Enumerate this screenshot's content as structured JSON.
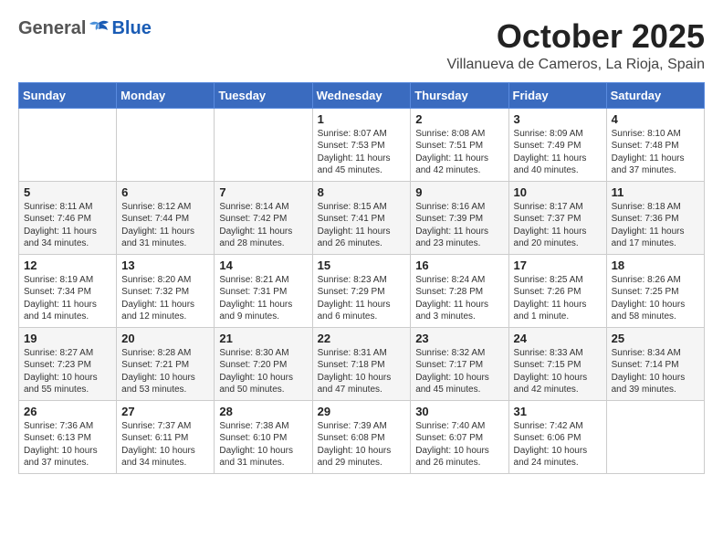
{
  "header": {
    "logo_general": "General",
    "logo_blue": "Blue",
    "month": "October 2025",
    "location": "Villanueva de Cameros, La Rioja, Spain"
  },
  "weekdays": [
    "Sunday",
    "Monday",
    "Tuesday",
    "Wednesday",
    "Thursday",
    "Friday",
    "Saturday"
  ],
  "weeks": [
    [
      {
        "day": "",
        "info": ""
      },
      {
        "day": "",
        "info": ""
      },
      {
        "day": "",
        "info": ""
      },
      {
        "day": "1",
        "info": "Sunrise: 8:07 AM\nSunset: 7:53 PM\nDaylight: 11 hours and 45 minutes."
      },
      {
        "day": "2",
        "info": "Sunrise: 8:08 AM\nSunset: 7:51 PM\nDaylight: 11 hours and 42 minutes."
      },
      {
        "day": "3",
        "info": "Sunrise: 8:09 AM\nSunset: 7:49 PM\nDaylight: 11 hours and 40 minutes."
      },
      {
        "day": "4",
        "info": "Sunrise: 8:10 AM\nSunset: 7:48 PM\nDaylight: 11 hours and 37 minutes."
      }
    ],
    [
      {
        "day": "5",
        "info": "Sunrise: 8:11 AM\nSunset: 7:46 PM\nDaylight: 11 hours and 34 minutes."
      },
      {
        "day": "6",
        "info": "Sunrise: 8:12 AM\nSunset: 7:44 PM\nDaylight: 11 hours and 31 minutes."
      },
      {
        "day": "7",
        "info": "Sunrise: 8:14 AM\nSunset: 7:42 PM\nDaylight: 11 hours and 28 minutes."
      },
      {
        "day": "8",
        "info": "Sunrise: 8:15 AM\nSunset: 7:41 PM\nDaylight: 11 hours and 26 minutes."
      },
      {
        "day": "9",
        "info": "Sunrise: 8:16 AM\nSunset: 7:39 PM\nDaylight: 11 hours and 23 minutes."
      },
      {
        "day": "10",
        "info": "Sunrise: 8:17 AM\nSunset: 7:37 PM\nDaylight: 11 hours and 20 minutes."
      },
      {
        "day": "11",
        "info": "Sunrise: 8:18 AM\nSunset: 7:36 PM\nDaylight: 11 hours and 17 minutes."
      }
    ],
    [
      {
        "day": "12",
        "info": "Sunrise: 8:19 AM\nSunset: 7:34 PM\nDaylight: 11 hours and 14 minutes."
      },
      {
        "day": "13",
        "info": "Sunrise: 8:20 AM\nSunset: 7:32 PM\nDaylight: 11 hours and 12 minutes."
      },
      {
        "day": "14",
        "info": "Sunrise: 8:21 AM\nSunset: 7:31 PM\nDaylight: 11 hours and 9 minutes."
      },
      {
        "day": "15",
        "info": "Sunrise: 8:23 AM\nSunset: 7:29 PM\nDaylight: 11 hours and 6 minutes."
      },
      {
        "day": "16",
        "info": "Sunrise: 8:24 AM\nSunset: 7:28 PM\nDaylight: 11 hours and 3 minutes."
      },
      {
        "day": "17",
        "info": "Sunrise: 8:25 AM\nSunset: 7:26 PM\nDaylight: 11 hours and 1 minute."
      },
      {
        "day": "18",
        "info": "Sunrise: 8:26 AM\nSunset: 7:25 PM\nDaylight: 10 hours and 58 minutes."
      }
    ],
    [
      {
        "day": "19",
        "info": "Sunrise: 8:27 AM\nSunset: 7:23 PM\nDaylight: 10 hours and 55 minutes."
      },
      {
        "day": "20",
        "info": "Sunrise: 8:28 AM\nSunset: 7:21 PM\nDaylight: 10 hours and 53 minutes."
      },
      {
        "day": "21",
        "info": "Sunrise: 8:30 AM\nSunset: 7:20 PM\nDaylight: 10 hours and 50 minutes."
      },
      {
        "day": "22",
        "info": "Sunrise: 8:31 AM\nSunset: 7:18 PM\nDaylight: 10 hours and 47 minutes."
      },
      {
        "day": "23",
        "info": "Sunrise: 8:32 AM\nSunset: 7:17 PM\nDaylight: 10 hours and 45 minutes."
      },
      {
        "day": "24",
        "info": "Sunrise: 8:33 AM\nSunset: 7:15 PM\nDaylight: 10 hours and 42 minutes."
      },
      {
        "day": "25",
        "info": "Sunrise: 8:34 AM\nSunset: 7:14 PM\nDaylight: 10 hours and 39 minutes."
      }
    ],
    [
      {
        "day": "26",
        "info": "Sunrise: 7:36 AM\nSunset: 6:13 PM\nDaylight: 10 hours and 37 minutes."
      },
      {
        "day": "27",
        "info": "Sunrise: 7:37 AM\nSunset: 6:11 PM\nDaylight: 10 hours and 34 minutes."
      },
      {
        "day": "28",
        "info": "Sunrise: 7:38 AM\nSunset: 6:10 PM\nDaylight: 10 hours and 31 minutes."
      },
      {
        "day": "29",
        "info": "Sunrise: 7:39 AM\nSunset: 6:08 PM\nDaylight: 10 hours and 29 minutes."
      },
      {
        "day": "30",
        "info": "Sunrise: 7:40 AM\nSunset: 6:07 PM\nDaylight: 10 hours and 26 minutes."
      },
      {
        "day": "31",
        "info": "Sunrise: 7:42 AM\nSunset: 6:06 PM\nDaylight: 10 hours and 24 minutes."
      },
      {
        "day": "",
        "info": ""
      }
    ]
  ]
}
